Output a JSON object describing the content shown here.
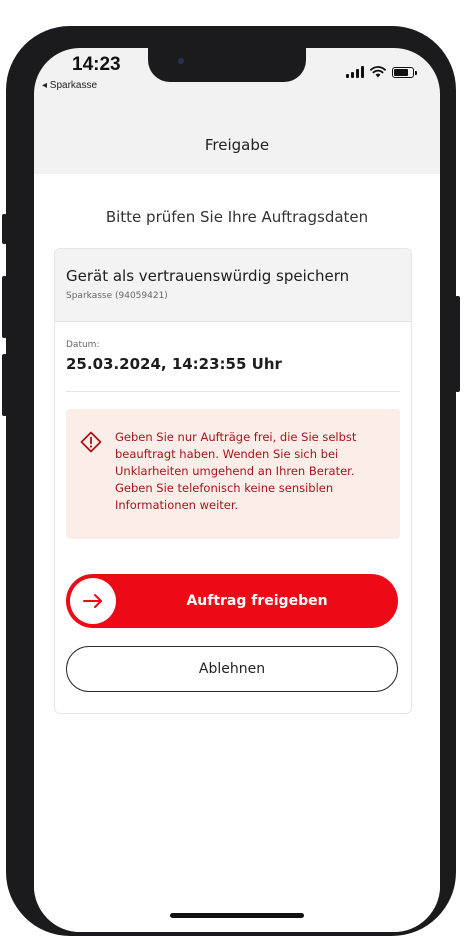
{
  "status_bar": {
    "time": "14:23",
    "back_app": "◂ Sparkasse"
  },
  "nav": {
    "title": "Freigabe"
  },
  "main": {
    "subtitle": "Bitte prüfen Sie Ihre Auftragsdaten"
  },
  "order": {
    "title": "Gerät als vertrauenswürdig speichern",
    "subtitle": "Sparkasse (94059421)",
    "date_label": "Datum:",
    "date_value": "25.03.2024, 14:23:55 Uhr"
  },
  "warning": {
    "icon": "warning-diamond-icon",
    "text": "Geben Sie nur Aufträge frei, die Sie selbst\nbeauftragt haben. Wenden Sie sich bei\nUnklarheiten umgehend an Ihren Berater.\nGeben Sie telefonisch keine sensiblen\nInformationen weiter."
  },
  "actions": {
    "approve_label": "Auftrag freigeben",
    "approve_icon": "arrow-right-icon",
    "reject_label": "Ablehnen"
  },
  "colors": {
    "brand_red": "#ec0a17",
    "warning_bg": "#fbeee9",
    "warning_text": "#a8141c"
  }
}
